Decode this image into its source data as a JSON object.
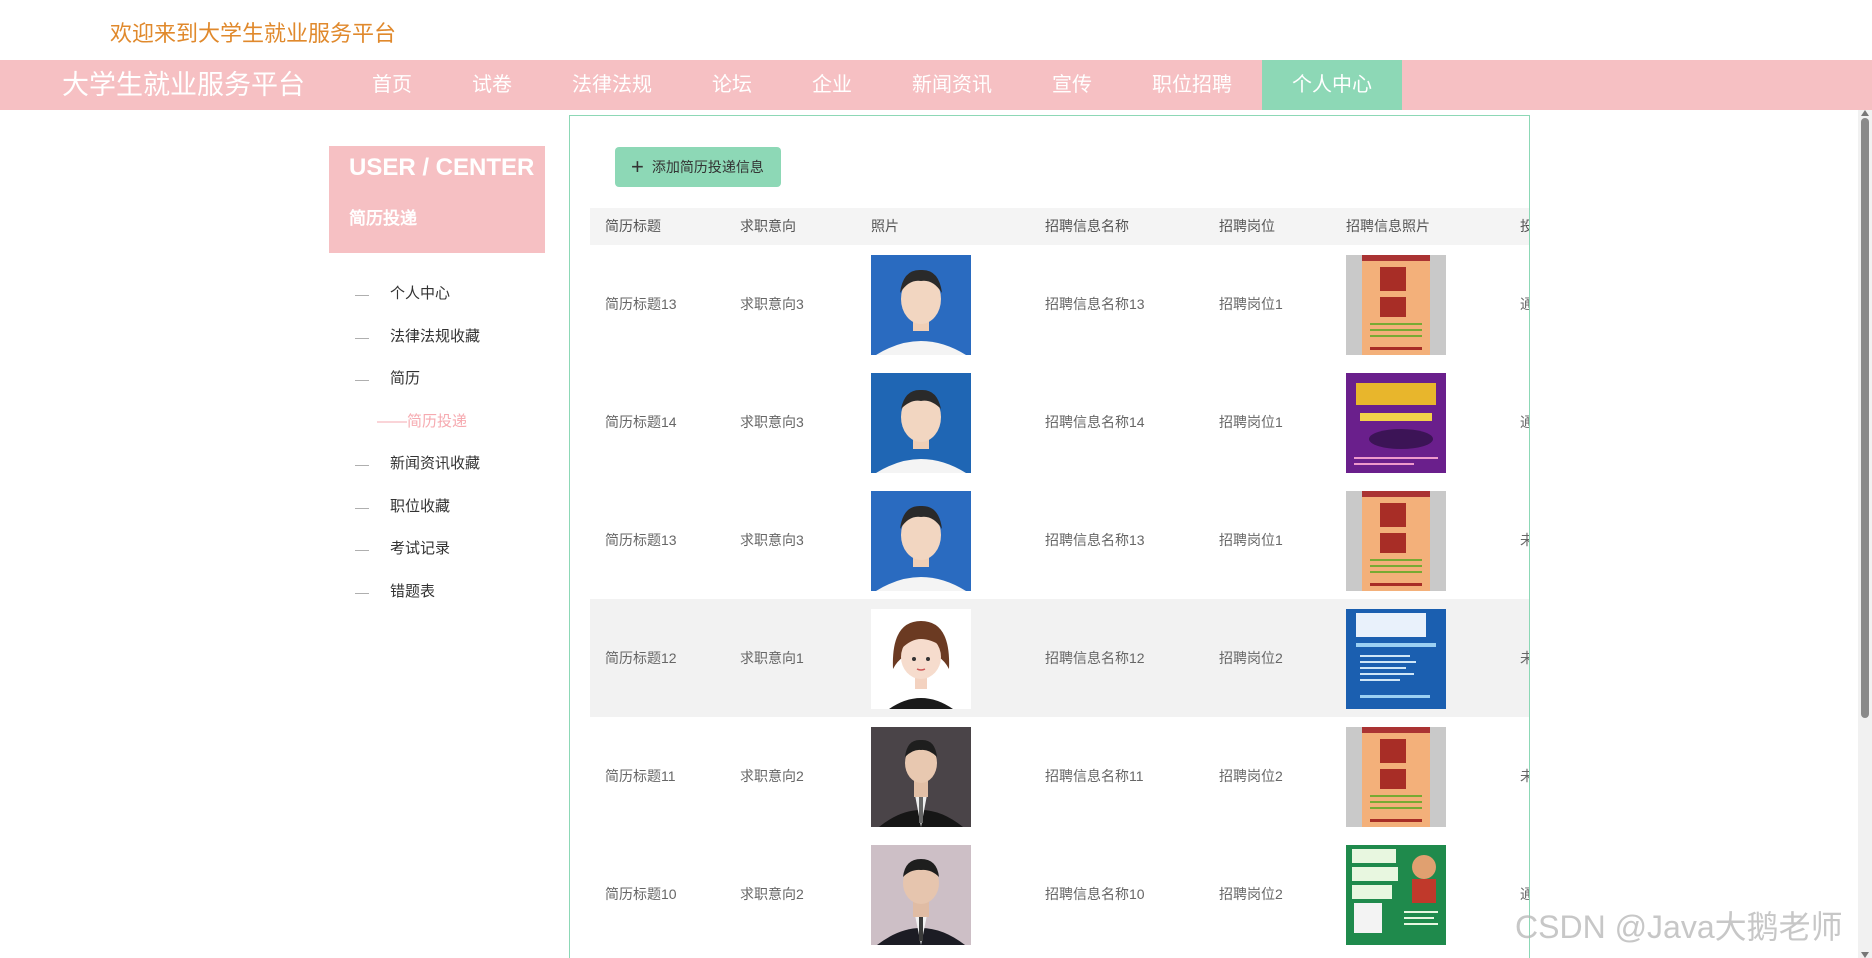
{
  "header": {
    "welcome": "欢迎来到大学生就业服务平台"
  },
  "navbar": {
    "brand": "大学生就业服务平台",
    "items": [
      "首页",
      "试卷",
      "法律法规",
      "论坛",
      "企业",
      "新闻资讯",
      "宣传",
      "职位招聘",
      "个人中心"
    ],
    "active_index": 8
  },
  "user_center": {
    "title": "USER / CENTER",
    "subtitle": "简历投递"
  },
  "side_menu": [
    "个人中心",
    "法律法规收藏",
    "简历",
    "简历投递",
    "新闻资讯收藏",
    "职位收藏",
    "考试记录",
    "错题表"
  ],
  "toolbar": {
    "add_label": "添加简历投递信息"
  },
  "table": {
    "headers": [
      "简历标题",
      "求职意向",
      "照片",
      "招聘信息名称",
      "招聘岗位",
      "招聘信息照片",
      "投"
    ],
    "rows": [
      {
        "title": "简历标题13",
        "intent": "求职意向3",
        "name": "招聘信息名称13",
        "post": "招聘岗位1",
        "status": "通"
      },
      {
        "title": "简历标题14",
        "intent": "求职意向3",
        "name": "招聘信息名称14",
        "post": "招聘岗位1",
        "status": "通"
      },
      {
        "title": "简历标题13",
        "intent": "求职意向3",
        "name": "招聘信息名称13",
        "post": "招聘岗位1",
        "status": "未"
      },
      {
        "title": "简历标题12",
        "intent": "求职意向1",
        "name": "招聘信息名称12",
        "post": "招聘岗位2",
        "status": "未"
      },
      {
        "title": "简历标题11",
        "intent": "求职意向2",
        "name": "招聘信息名称11",
        "post": "招聘岗位2",
        "status": "未"
      },
      {
        "title": "简历标题10",
        "intent": "求职意向2",
        "name": "招聘信息名称10",
        "post": "招聘岗位2",
        "status": "通"
      }
    ]
  },
  "colors": {
    "nav_pink": "#f6c0c3",
    "accent_green": "#8dd8b6",
    "welcome_orange": "#e0892c"
  },
  "watermark": "CSDN @Java大鹅老师"
}
